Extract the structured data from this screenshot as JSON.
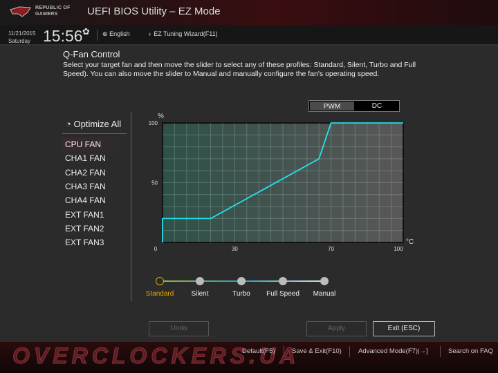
{
  "header": {
    "brand_line1": "REPUBLIC OF",
    "brand_line2": "GAMERS",
    "title": "UEFI BIOS Utility – EZ Mode",
    "date": "11/21/2015",
    "day": "Saturday",
    "time": "15:56",
    "language": "English",
    "wizard": "EZ Tuning Wizard(F11)"
  },
  "qfan": {
    "title": "Q-Fan Control",
    "description": "Select your target fan and then move the slider to select any of these profiles: Standard, Silent, Turbo and Full Speed). You can also move the slider to Manual and manually configure the fan's operating speed."
  },
  "fans": {
    "optimize": "Optimize All",
    "items": [
      "CPU FAN",
      "CHA1 FAN",
      "CHA2 FAN",
      "CHA3 FAN",
      "CHA4 FAN",
      "EXT FAN1",
      "EXT FAN2",
      "EXT FAN3"
    ],
    "selected": "CPU FAN"
  },
  "mode_toggle": {
    "options": [
      "PWM",
      "DC"
    ],
    "selected": "PWM"
  },
  "chart_data": {
    "type": "line",
    "xlabel": "°C",
    "ylabel": "%",
    "xlim": [
      0,
      100
    ],
    "ylim": [
      0,
      100
    ],
    "xticks": [
      0,
      30,
      70,
      100
    ],
    "yticks": [
      50,
      100
    ],
    "grid": true,
    "series": [
      {
        "color": "#22e4ef",
        "points": [
          [
            0,
            0
          ],
          [
            0,
            20
          ],
          [
            20,
            20
          ],
          [
            65,
            70
          ],
          [
            70,
            100
          ],
          [
            100,
            100
          ]
        ]
      }
    ]
  },
  "profiles": {
    "items": [
      "Standard",
      "Silent",
      "Turbo",
      "Full Speed",
      "Manual"
    ],
    "selected": "Standard",
    "selected_color": "#e0a800"
  },
  "buttons": {
    "undo": "Undo",
    "apply": "Apply",
    "exit": "Exit (ESC)"
  },
  "footer": {
    "default": "Default(F5)",
    "save_exit": "Save & Exit(F10)",
    "advanced": "Advanced Mode(F7)|",
    "faq": "Search on FAQ",
    "watermark": "OVERCLOCKERS.UA"
  }
}
